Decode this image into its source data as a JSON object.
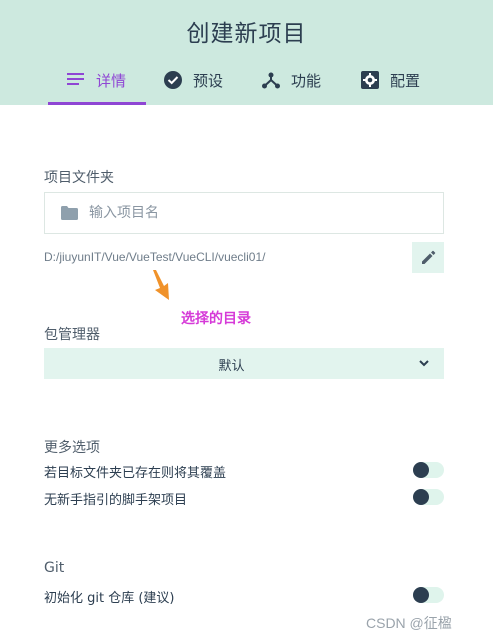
{
  "header": {
    "title": "创建新项目",
    "tabs": [
      {
        "label": "详情",
        "icon": "list-icon",
        "active": true
      },
      {
        "label": "预设",
        "icon": "check-circle-icon",
        "active": false
      },
      {
        "label": "功能",
        "icon": "fork-icon",
        "active": false
      },
      {
        "label": "配置",
        "icon": "gear-icon",
        "active": false
      }
    ],
    "accent_color": "#8f46d4",
    "background_color": "#cde9df"
  },
  "project_folder": {
    "label": "项目文件夹",
    "placeholder": "输入项目名",
    "path": "D:/jiuyunIT/Vue/VueTest/VueCLI/vuecli01/"
  },
  "annotation": {
    "text": "选择的目录",
    "color": "#d63ad8"
  },
  "package_manager": {
    "label": "包管理器",
    "selected": "默认"
  },
  "more_options": {
    "label": "更多选项",
    "options": [
      {
        "label": "若目标文件夹已存在则将其覆盖",
        "enabled": false
      },
      {
        "label": "无新手指引的脚手架项目",
        "enabled": false
      }
    ]
  },
  "git": {
    "label": "Git",
    "options": [
      {
        "label": "初始化 git 仓库 (建议)",
        "enabled": false
      }
    ]
  },
  "watermark": "CSDN @征楹"
}
